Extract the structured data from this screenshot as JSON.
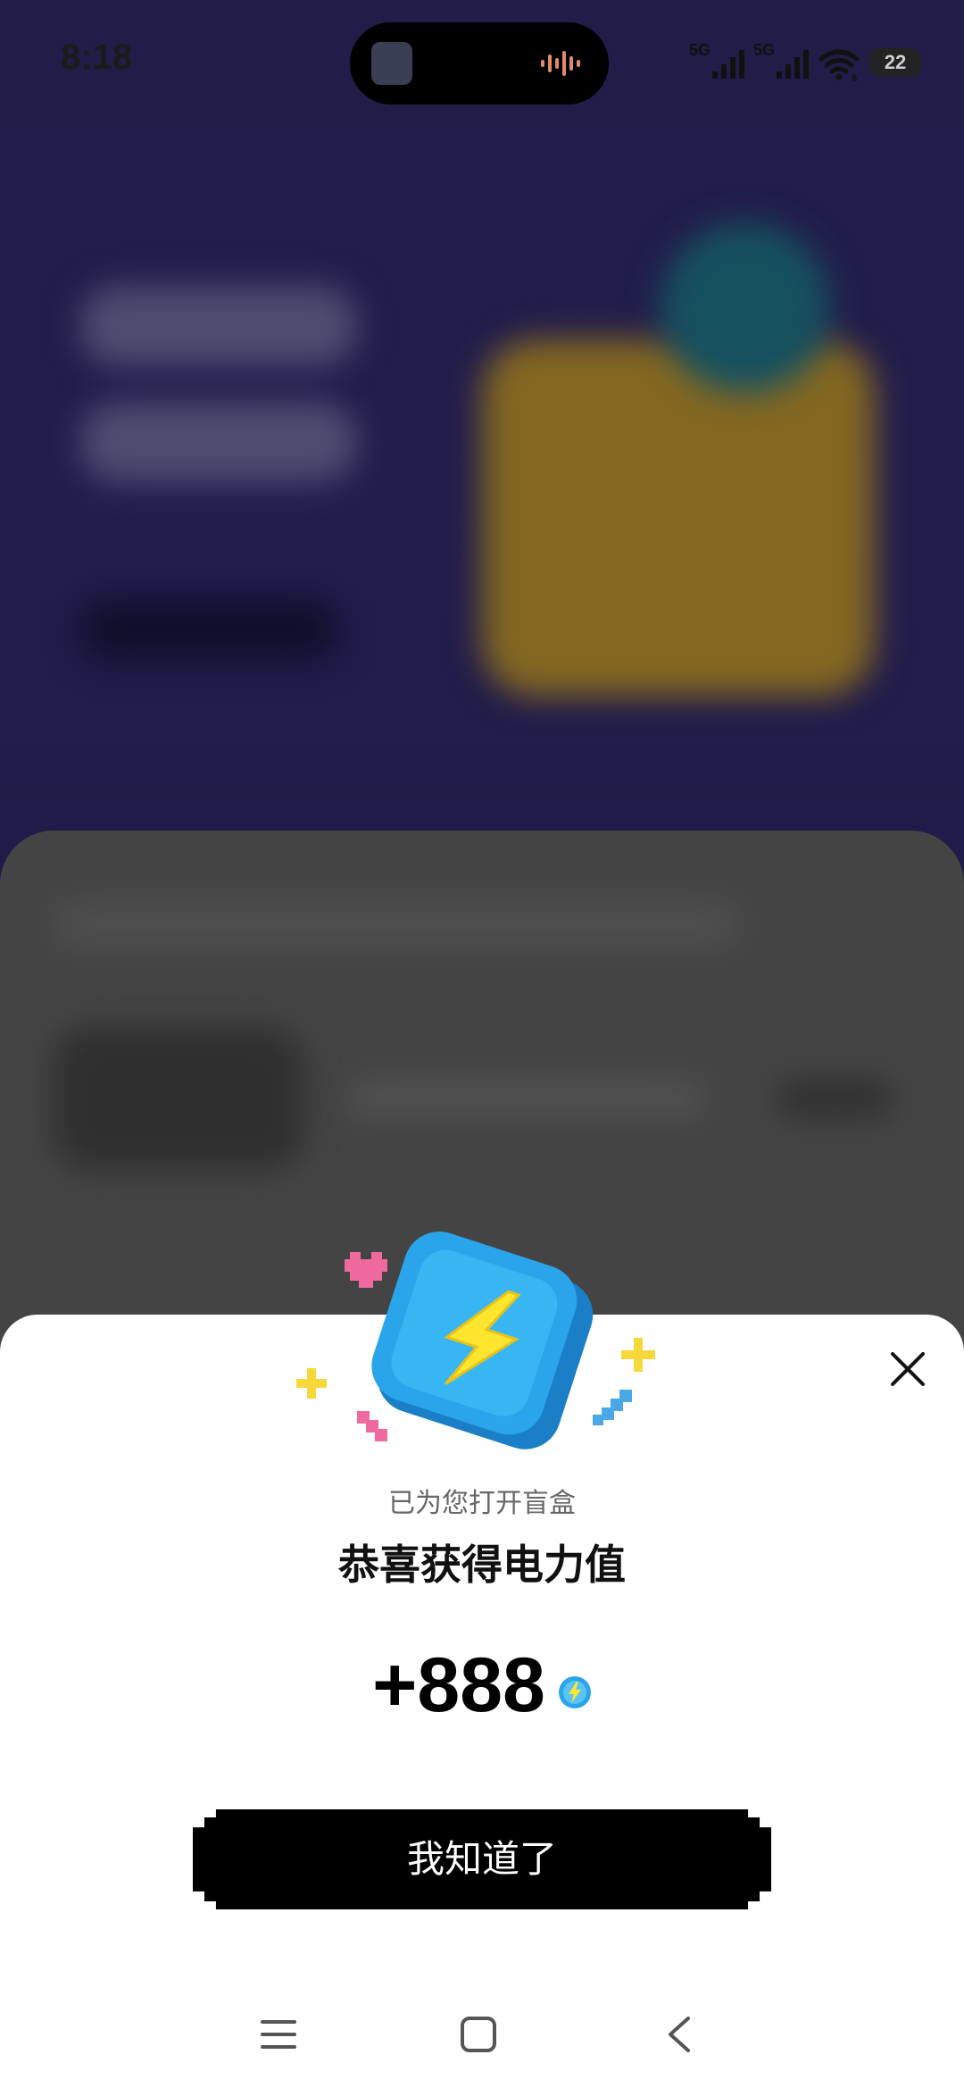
{
  "status_bar": {
    "time": "8:18",
    "signal_1_label": "5G",
    "signal_2_label": "5G",
    "wifi_badge": "6",
    "battery": "22"
  },
  "dialog": {
    "subtitle": "已为您打开盲盒",
    "title": "恭喜获得电力值",
    "reward_value": "+888",
    "confirm_label": "我知道了"
  },
  "icons": {
    "close": "close-icon",
    "reward": "lightning-coin-icon",
    "energy": "energy-icon",
    "nav_menu": "menu-icon",
    "nav_home": "home-icon",
    "nav_back": "back-icon"
  },
  "colors": {
    "accent_blue": "#29a3e6",
    "bolt_yellow": "#ffe62e",
    "button_black": "#000000",
    "sheet_white": "#ffffff"
  }
}
